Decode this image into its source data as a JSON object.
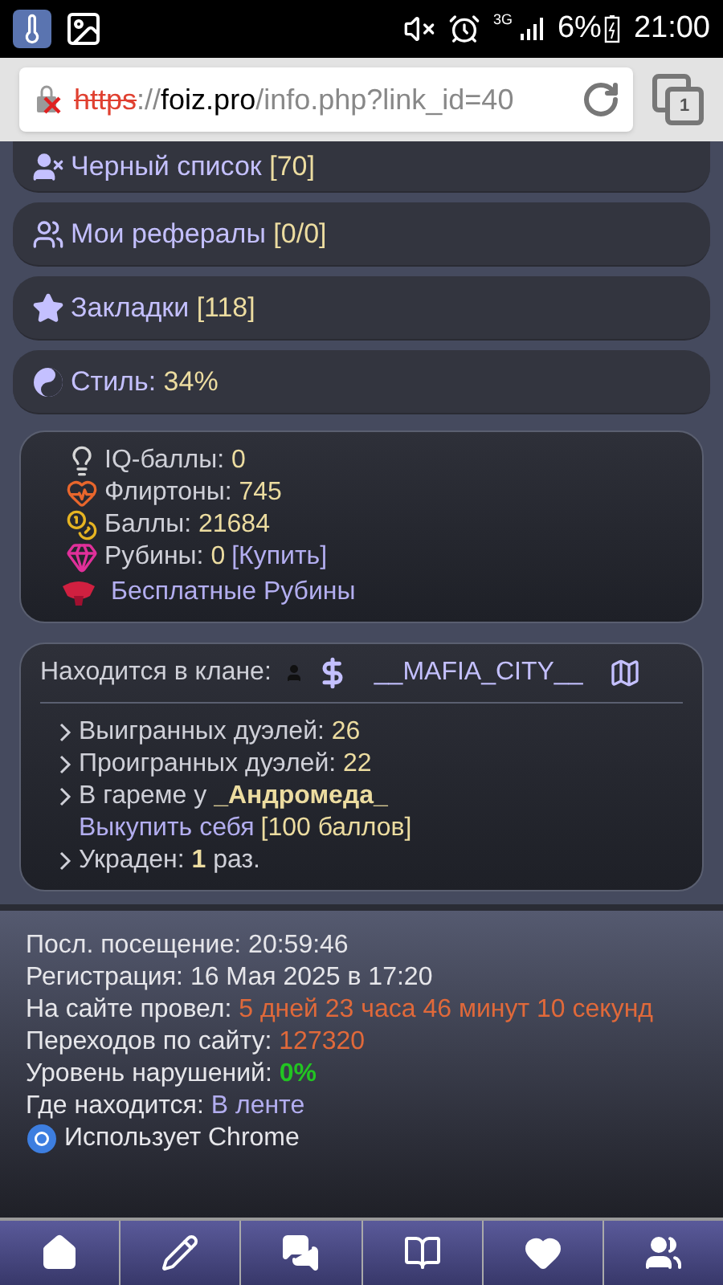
{
  "status_bar": {
    "network": "3G",
    "battery": "6%",
    "time": "21:00"
  },
  "browser": {
    "url": {
      "scheme": "https",
      "separator": "://",
      "host": "foiz.pro",
      "path": "/info.php?link_id=40"
    },
    "tab_count": "1"
  },
  "menu": [
    {
      "kind": "blacklist",
      "label": "Черный список",
      "value": "[70]"
    },
    {
      "kind": "referrals",
      "label": "Мои рефералы",
      "value": "[0/0]"
    },
    {
      "kind": "bookmarks",
      "label": "Закладки",
      "value": "[118]"
    },
    {
      "kind": "style",
      "label": "Стиль:",
      "value": "34%"
    }
  ],
  "balances": [
    {
      "kind": "iq",
      "label": "IQ-баллы:",
      "value": "0"
    },
    {
      "kind": "flirtons",
      "label": "Флиртоны:",
      "value": "745"
    },
    {
      "kind": "points",
      "label": "Баллы:",
      "value": "21684"
    },
    {
      "kind": "rubies",
      "label": "Рубины:",
      "value": "0",
      "link": "[Купить]"
    }
  ],
  "free_rubies": "Бесплатные Рубины",
  "clan": {
    "label": "Находится в клане:",
    "name": "__MAFIA_CITY__"
  },
  "duels": [
    {
      "kind": "stat",
      "label": "Выигранных дуэлей:",
      "value": "26"
    },
    {
      "kind": "stat",
      "label": "Проигранных дуэлей:",
      "value": "22"
    },
    {
      "kind": "harem",
      "label": "В гареме у",
      "value": "_Андромеда_",
      "link": "Выкупить себя",
      "price": "[100 баллов]"
    },
    {
      "kind": "stolen",
      "label": "Украден:",
      "value": "1",
      "suffix": "раз."
    }
  ],
  "info": [
    {
      "label": "Посл. посещение:",
      "value": "20:59:46",
      "kind": "plain"
    },
    {
      "label": "Регистрация:",
      "value": "16 Мая 2025 в 17:20",
      "kind": "plain"
    },
    {
      "label": "На сайте провел:",
      "value": "5 дней 23 часа 46 минут 10 секунд",
      "kind": "orange"
    },
    {
      "label": "Переходов по сайту:",
      "value": "127320",
      "kind": "orange"
    },
    {
      "label": "Уровень нарушений:",
      "value": "0%",
      "kind": "green"
    },
    {
      "label": "Где находится:",
      "value": "В ленте",
      "kind": "link"
    },
    {
      "label": "Использует Chrome",
      "kind": "browser"
    }
  ],
  "nav": [
    {
      "kind": "home"
    },
    {
      "kind": "edit"
    },
    {
      "kind": "chat"
    },
    {
      "kind": "book"
    },
    {
      "kind": "heart"
    },
    {
      "kind": "people"
    }
  ]
}
